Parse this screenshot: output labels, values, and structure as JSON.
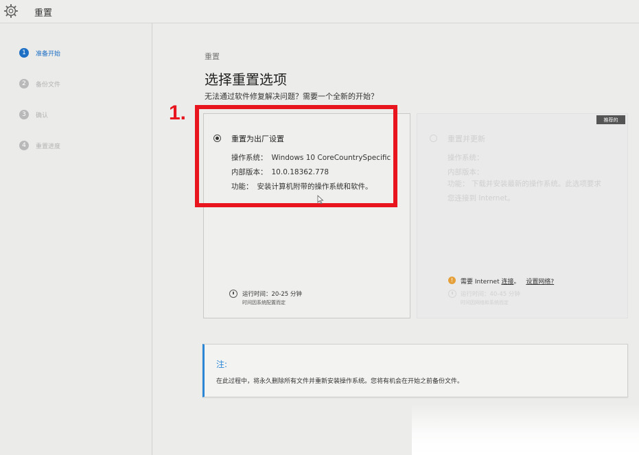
{
  "window": {
    "title": "重置"
  },
  "sidebar": {
    "steps": [
      {
        "num": "1",
        "label": "准备开始",
        "active": true
      },
      {
        "num": "2",
        "label": "备份文件",
        "active": false
      },
      {
        "num": "3",
        "label": "确认",
        "active": false
      },
      {
        "num": "4",
        "label": "重置进度",
        "active": false
      }
    ]
  },
  "main": {
    "breadcrumb": "重置",
    "heading": "选择重置选项",
    "subheading": "无法通过软件修复解决问题？需要一个全新的开始？"
  },
  "option_factory": {
    "title": "重置为出厂设置",
    "selected": true,
    "os_label": "操作系统：",
    "os_value": "Windows 10 CoreCountrySpecific",
    "build_label": "内部版本：",
    "build_value": "10.0.18362.778",
    "feature_label": "功能：",
    "feature_value": "安装计算机附带的操作系统和软件。",
    "runtime": "运行时间：20-25 分钟",
    "runtime_note": "时间因系统配置而定"
  },
  "option_update": {
    "title": "重置并更新",
    "selected": false,
    "recommended_badge": "推荐的",
    "os_label": "操作系统：",
    "build_label": "内部版本：",
    "feature_text": "功能：  下载并安装最新的操作系统。此选项要求您连接到 Internet。",
    "internet_prefix": "需要 Internet ",
    "internet_link": "连接",
    "internet_sep": "。",
    "network_link": "设置网络?",
    "runtime": "运行时间：40-45 分钟",
    "runtime_note": "时间因网络和系统而定"
  },
  "note": {
    "title": "注:",
    "text": "在此过程中，将永久删除所有文件并重新安装操作系统。您将有机会在开始之前备份文件。"
  },
  "annotation": {
    "step_mark": "1."
  },
  "colors": {
    "accent": "#1d70c4",
    "highlight": "#e8151f",
    "note_bar": "#2b86d6",
    "warning": "#e5a03a"
  }
}
